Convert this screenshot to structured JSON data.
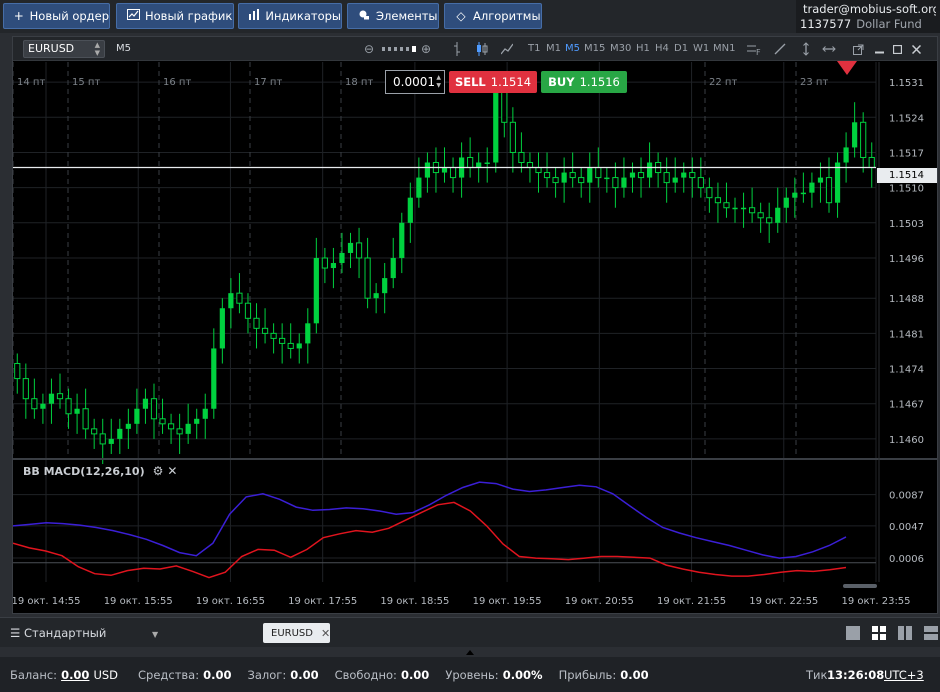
{
  "toolbar": {
    "new_order": "Новый ордер",
    "new_chart": "Новый график",
    "indicators": "Индикаторы",
    "elements": "Элементы",
    "algorithms": "Алгоритмы"
  },
  "account": {
    "email": "trader@mobius-soft.org",
    "number": "1137577",
    "fund": "Dollar Fund"
  },
  "chart": {
    "symbol": "EURUSD",
    "period": "M5",
    "timeframes": [
      "T1",
      "M1",
      "M5",
      "M15",
      "M30",
      "H1",
      "H4",
      "D1",
      "W1",
      "MN1"
    ],
    "active_timeframe": "M5",
    "lot": "0.0001",
    "sell_label": "SELL",
    "sell_price": "1.1514",
    "buy_label": "BUY",
    "buy_price": "1.1516",
    "current_price": "1.1514",
    "price_ticks": [
      "1.1531",
      "1.1524",
      "1.1517",
      "1.1510",
      "1.1503",
      "1.1496",
      "1.1488",
      "1.1481",
      "1.1474",
      "1.1467",
      "1.1460"
    ],
    "day_labels": [
      "14 пт",
      "15 пт",
      "16 пт",
      "17 пт",
      "18 пт",
      "22 пт",
      "23 пт"
    ],
    "time_labels": [
      "19 окт. 14:55",
      "19 окт. 15:55",
      "19 окт. 16:55",
      "19 окт. 17:55",
      "19 окт. 18:55",
      "19 окт. 19:55",
      "19 окт. 20:55",
      "19 окт. 21:55",
      "19 окт. 22:55",
      "19 окт. 23:55"
    ],
    "macd_title": "BB MACD(12,26,10)",
    "macd_ticks": [
      "0.0087",
      "0.0047",
      "0.0006"
    ],
    "colors": {
      "bull": "#00d13f",
      "macd_upper": "#3b1fd6",
      "macd_lower": "#e0141e",
      "background": "#000000"
    }
  },
  "chart_data": {
    "type": "candlestick",
    "symbol": "EURUSD",
    "timeframe": "M5",
    "x_range": [
      "19 окт. 14:55",
      "19 окт. 23:55"
    ],
    "ylim": [
      1.1456,
      1.1535
    ],
    "closes": [
      1.1472,
      1.1468,
      1.1466,
      1.1467,
      1.1469,
      1.1468,
      1.1465,
      1.1466,
      1.1462,
      1.1461,
      1.1459,
      1.146,
      1.1462,
      1.1463,
      1.1466,
      1.1468,
      1.1464,
      1.1463,
      1.1462,
      1.1461,
      1.1463,
      1.1464,
      1.1466,
      1.1478,
      1.1486,
      1.1489,
      1.1487,
      1.1484,
      1.1482,
      1.1481,
      1.148,
      1.1479,
      1.1478,
      1.1479,
      1.1483,
      1.1496,
      1.1494,
      1.1495,
      1.1497,
      1.1499,
      1.1496,
      1.1488,
      1.1489,
      1.1492,
      1.1496,
      1.1503,
      1.1508,
      1.1512,
      1.1515,
      1.1513,
      1.1514,
      1.1512,
      1.1516,
      1.1514,
      1.1515,
      1.1515,
      1.1529,
      1.1523,
      1.1517,
      1.1515,
      1.1514,
      1.1513,
      1.1512,
      1.1511,
      1.1513,
      1.1512,
      1.1511,
      1.1514,
      1.1512,
      1.1512,
      1.151,
      1.1512,
      1.1513,
      1.1512,
      1.1515,
      1.1513,
      1.1511,
      1.1512,
      1.1513,
      1.1512,
      1.151,
      1.1508,
      1.1507,
      1.1506,
      1.1506,
      1.1506,
      1.1505,
      1.1504,
      1.1503,
      1.1506,
      1.1508,
      1.1509,
      1.1509,
      1.1511,
      1.1512,
      1.1507,
      1.1515,
      1.1518,
      1.1523,
      1.1516,
      1.1514
    ],
    "macd_upper": [
      0.0047,
      0.0049,
      0.0051,
      0.005,
      0.0048,
      0.0045,
      0.0041,
      0.0036,
      0.003,
      0.0022,
      0.0013,
      0.0009,
      0.0025,
      0.0062,
      0.0084,
      0.0088,
      0.0081,
      0.0071,
      0.0067,
      0.0068,
      0.007,
      0.0069,
      0.0066,
      0.0062,
      0.0064,
      0.0074,
      0.0086,
      0.0096,
      0.0103,
      0.0101,
      0.0094,
      0.0091,
      0.0093,
      0.0096,
      0.0099,
      0.0097,
      0.0088,
      0.0073,
      0.0058,
      0.0045,
      0.0038,
      0.0032,
      0.0027,
      0.0022,
      0.0016,
      0.001,
      0.0006,
      0.0008,
      0.0014,
      0.0022,
      0.0033
    ],
    "macd_lower": [
      0.0025,
      0.0019,
      0.0015,
      0.0009,
      -0.0005,
      -0.0014,
      -0.0016,
      -0.001,
      -0.0007,
      -0.0008,
      -0.0004,
      -0.0011,
      -0.0019,
      -0.0012,
      0.0008,
      0.0017,
      0.0016,
      0.0007,
      0.0017,
      0.0032,
      0.0037,
      0.0041,
      0.0039,
      0.0044,
      0.0054,
      0.0064,
      0.0074,
      0.0077,
      0.0066,
      0.0047,
      0.0024,
      0.0008,
      0.0006,
      0.0005,
      0.0004,
      0.0006,
      0.0008,
      0.0008,
      0.0007,
      0.0006,
      -0.0003,
      -0.0008,
      -0.0012,
      -0.0015,
      -0.0017,
      -0.0017,
      -0.0015,
      -0.0012,
      -0.001,
      -0.0011,
      -0.0009,
      -0.0006
    ]
  },
  "bottom": {
    "workspace": "Стандартный",
    "chart_tab": "EURUSD"
  },
  "status": {
    "balance_label": "Баланс:",
    "balance_value": "0.00",
    "balance_currency": "USD",
    "equity_label": "Средства:",
    "equity_value": "0.00",
    "margin_label": "Залог:",
    "margin_value": "0.00",
    "free_label": "Свободно:",
    "free_value": "0.00",
    "level_label": "Уровень:",
    "level_value": "0.00%",
    "profit_label": "Прибыль:",
    "profit_value": "0.00",
    "tick_label": "Тик",
    "time": "13:26:08",
    "timezone": "UTC+3"
  }
}
